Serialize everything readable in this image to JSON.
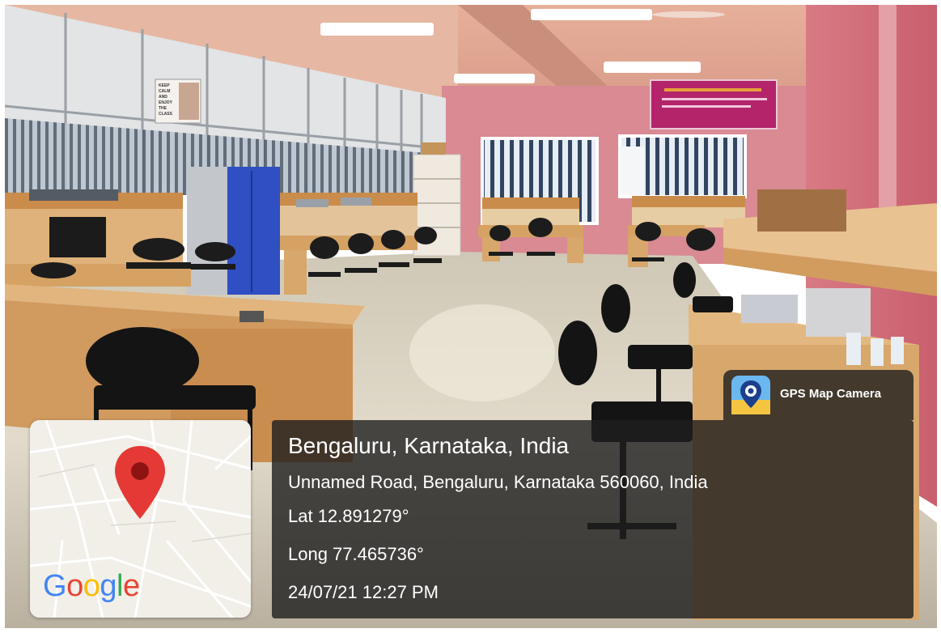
{
  "overlay": {
    "app_name": "GPS Map Camera",
    "location_title": "Bengaluru, Karnataka, India",
    "address": "Unnamed Road, Bengaluru, Karnataka 560060, India",
    "latitude": "Lat 12.891279°",
    "longitude": "Long 77.465736°",
    "datetime": "24/07/21 12:27 PM"
  },
  "map": {
    "logo_letters": [
      {
        "ch": "G",
        "color": "#4285F4"
      },
      {
        "ch": "o",
        "color": "#EA4335"
      },
      {
        "ch": "o",
        "color": "#FBBC05"
      },
      {
        "ch": "g",
        "color": "#4285F4"
      },
      {
        "ch": "l",
        "color": "#34A853"
      },
      {
        "ch": "e",
        "color": "#EA4335"
      }
    ],
    "marker_icon": "map-pin-icon",
    "marker_color": "#E53935"
  },
  "poster": {
    "lines": [
      "KEEP",
      "CALM",
      "AND",
      "ENJOY",
      "THE",
      "CLASS"
    ]
  },
  "colors": {
    "wall_pink": "#d9858e",
    "desk_wood": "#d7a76b",
    "floor": "#d8d0bf",
    "ceiling": "#e8b39a",
    "panel_bg": "rgba(30,30,30,0.80)"
  }
}
